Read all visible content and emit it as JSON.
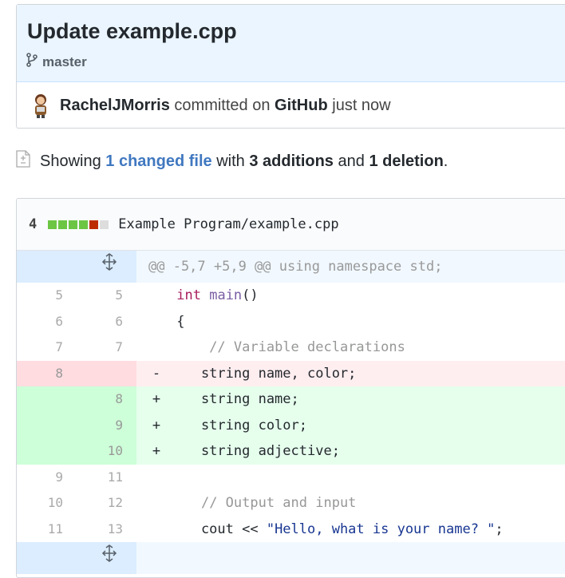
{
  "commit": {
    "title": "Update example.cpp",
    "branch": "master",
    "author": "RachelJMorris",
    "committed_on": "committed on",
    "platform": "GitHub",
    "time": "just now"
  },
  "summary": {
    "showing": "Showing",
    "changed_files": "1 changed file",
    "with": "with",
    "additions": "3 additions",
    "and": "and",
    "deletions": "1 deletion",
    "period": "."
  },
  "file": {
    "changes_count": "4",
    "diffstat": [
      "add",
      "add",
      "add",
      "add",
      "del",
      "neutral"
    ],
    "path": "Example Program/example.cpp",
    "hunk_header": "@@ -5,7 +5,9 @@ using namespace std;",
    "lines": [
      {
        "type": "ctx",
        "old": "5",
        "new": "5",
        "sign": "",
        "code": " int main()"
      },
      {
        "type": "ctx",
        "old": "6",
        "new": "6",
        "sign": "",
        "code": " {"
      },
      {
        "type": "ctx",
        "old": "7",
        "new": "7",
        "sign": "",
        "code": "     // Variable declarations"
      },
      {
        "type": "del",
        "old": "8",
        "new": "",
        "sign": "-",
        "code": "    string name, color;"
      },
      {
        "type": "add",
        "old": "",
        "new": "8",
        "sign": "+",
        "code": "    string name;"
      },
      {
        "type": "add",
        "old": "",
        "new": "9",
        "sign": "+",
        "code": "    string color;"
      },
      {
        "type": "add",
        "old": "",
        "new": "10",
        "sign": "+",
        "code": "    string adjective;"
      },
      {
        "type": "ctx",
        "old": "9",
        "new": "11",
        "sign": "",
        "code": ""
      },
      {
        "type": "ctx",
        "old": "10",
        "new": "12",
        "sign": "",
        "code": "    // Output and input"
      },
      {
        "type": "ctx",
        "old": "11",
        "new": "13",
        "sign": "",
        "code": "    cout << \"Hello, what is your name? \";"
      }
    ]
  },
  "colors": {
    "add_bar": "#6cc644",
    "del_bar": "#bd2c00",
    "neutral_bar": "#ddd",
    "link": "#4078c0"
  }
}
